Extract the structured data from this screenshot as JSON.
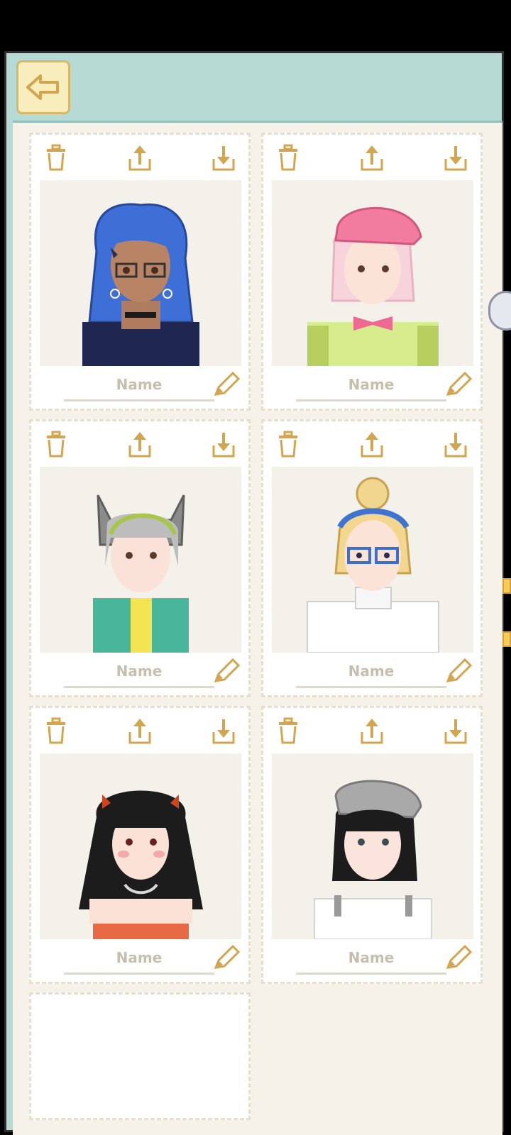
{
  "screen": "saved-characters",
  "colors": {
    "frame_bg": "#b6dad4",
    "panel_bg": "#f6f2ea",
    "accent_gold": "#d2a54e",
    "button_fill": "#f7edbd",
    "name_placeholder": "#c7bfae"
  },
  "header": {
    "back_icon": "arrow-left-icon"
  },
  "slot_tools": {
    "delete_icon": "trash-icon",
    "export_icon": "upload-icon",
    "import_icon": "download-icon",
    "edit_icon": "pencil-icon"
  },
  "slots": [
    {
      "name": "Name",
      "character": "blue wavy hair, glasses, heart earrings, navy knit top"
    },
    {
      "name": "Name",
      "character": "pink hair, pink beret, bow tie, lime sweater"
    },
    {
      "name": "Name",
      "character": "grey hair, cat-ear hood, green vest"
    },
    {
      "name": "Name",
      "character": "blonde bun, blue headband, blue glasses, white zip top"
    },
    {
      "name": "Name",
      "character": "black curly hair, red bows, orange tube top"
    },
    {
      "name": "Name",
      "character": "black hair, grey beret, white knit top"
    }
  ]
}
